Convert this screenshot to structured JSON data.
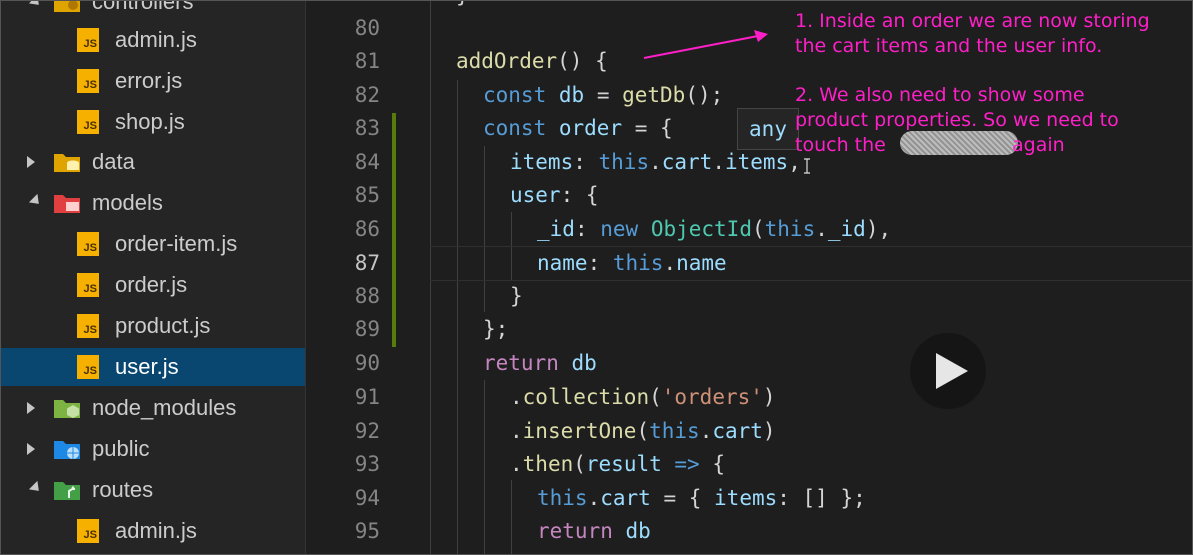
{
  "sidebar": {
    "items": [
      {
        "label": "controllers",
        "type": "folder-open",
        "icon": "gear-folder-icon"
      },
      {
        "label": "admin.js",
        "type": "file",
        "icon": "js-file-icon"
      },
      {
        "label": "error.js",
        "type": "file",
        "icon": "js-file-icon"
      },
      {
        "label": "shop.js",
        "type": "file",
        "icon": "js-file-icon"
      },
      {
        "label": "data",
        "type": "folder",
        "icon": "database-folder-icon"
      },
      {
        "label": "models",
        "type": "folder-open",
        "icon": "models-folder-icon"
      },
      {
        "label": "order-item.js",
        "type": "file",
        "icon": "js-file-icon"
      },
      {
        "label": "order.js",
        "type": "file",
        "icon": "js-file-icon"
      },
      {
        "label": "product.js",
        "type": "file",
        "icon": "js-file-icon"
      },
      {
        "label": "user.js",
        "type": "file",
        "icon": "js-file-icon",
        "selected": true
      },
      {
        "label": "node_modules",
        "type": "folder",
        "icon": "node-folder-icon"
      },
      {
        "label": "public",
        "type": "folder",
        "icon": "globe-folder-icon"
      },
      {
        "label": "routes",
        "type": "folder-open",
        "icon": "routes-folder-icon"
      },
      {
        "label": "admin.js",
        "type": "file",
        "icon": "js-file-icon"
      }
    ],
    "js_badge": "JS"
  },
  "editor": {
    "line_numbers": [
      "80",
      "81",
      "82",
      "83",
      "84",
      "85",
      "86",
      "87",
      "88",
      "89",
      "90",
      "91",
      "92",
      "93",
      "94",
      "95"
    ],
    "active_line": "87",
    "hover_type": "any"
  },
  "annotations": {
    "note1_line1": "1. Inside an order we are now storing",
    "note1_line2": "the cart items and the user info.",
    "note2_line1": "2. We also need to show some",
    "note2_line2": "product properties. So we need to",
    "note2_line3a": "touch the",
    "note2_line3b": "again",
    "color": "#ff1fc8"
  },
  "colors": {
    "sidebar_bg": "#252526",
    "selected_bg": "#094771",
    "editor_bg": "#1e1e1e",
    "keyword": "#569cd6",
    "control_keyword": "#c586c0",
    "function": "#dcdcaa",
    "variable": "#9cdcfe",
    "string": "#ce9178",
    "class": "#4ec9b0"
  },
  "code": {
    "l80": "}",
    "l81_fn": "addOrder",
    "l81_rest": "() {",
    "l82_kw": "const",
    "l82_var": "db",
    "l82_eq": " = ",
    "l82_fn": "getDb",
    "l82_end": "();",
    "l83_kw": "const",
    "l83_var": "order",
    "l83_end": " = {",
    "l84_prop": "items",
    "l84_colon": ": ",
    "l84_this": "this",
    "l84_dot1": ".",
    "l84_cart": "cart",
    "l84_dot2": ".",
    "l84_items": "items",
    "l84_end": ",",
    "l85_prop": "user",
    "l85_end": ": {",
    "l86_prop": "_id",
    "l86_colon": ": ",
    "l86_new": "new",
    "l86_cls": "ObjectId",
    "l86_open": "(",
    "l86_this": "this",
    "l86_dot": ".",
    "l86_id": "_id",
    "l86_end": "),",
    "l87_prop": "name",
    "l87_colon": ": ",
    "l87_this": "this",
    "l87_dot": ".",
    "l87_name": "name",
    "l88": "}",
    "l89": "};",
    "l90_kw": "return",
    "l90_var": "db",
    "l91_dot": ".",
    "l91_fn": "collection",
    "l91_open": "(",
    "l91_str": "'orders'",
    "l91_end": ")",
    "l92_dot": ".",
    "l92_fn": "insertOne",
    "l92_open": "(",
    "l92_this": "this",
    "l92_dot2": ".",
    "l92_cart": "cart",
    "l92_end": ")",
    "l93_dot": ".",
    "l93_fn": "then",
    "l93_open": "(",
    "l93_param": "result",
    "l93_arrow": " => ",
    "l93_end": "{",
    "l94_this": "this",
    "l94_dot": ".",
    "l94_cart": "cart",
    "l94_eq": " = { ",
    "l94_prop": "items",
    "l94_end": ": [] };",
    "l95_kw": "return",
    "l95_var": "db"
  }
}
